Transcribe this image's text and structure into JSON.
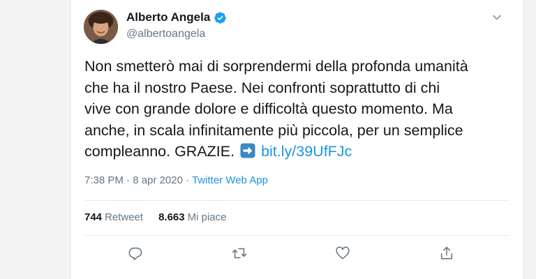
{
  "user": {
    "name": "Alberto Angela",
    "handle": "@albertoangela"
  },
  "tweet": {
    "lines": [
      "Non smetterò mai di sorprendermi della profonda umanità",
      "che ha il nostro Paese. Nei confronti soprattutto di chi",
      "vive con grande dolore e difficoltà questo momento. Ma",
      "anche, in scala infinitamente più piccola, per un semplice"
    ],
    "last_line": "compleanno. GRAZIE.",
    "link": "bit.ly/39UfFJc"
  },
  "meta": {
    "time": "7:38 PM · 8 apr 2020 · ",
    "source": "Twitter Web App"
  },
  "stats": {
    "retweets_count": "744",
    "retweets_label": "Retweet",
    "likes_count": "8.663",
    "likes_label": "Mi piace"
  },
  "icons": {
    "verified": "verified-badge-icon",
    "chevron": "chevron-down-icon",
    "reply": "reply-icon",
    "retweet": "retweet-icon",
    "like": "heart-icon",
    "share": "share-icon",
    "arrow": "arrow-right-emoji"
  },
  "colors": {
    "accent": "#1b95e0",
    "secondary_text": "#657786",
    "verified": "#1da1f2"
  }
}
